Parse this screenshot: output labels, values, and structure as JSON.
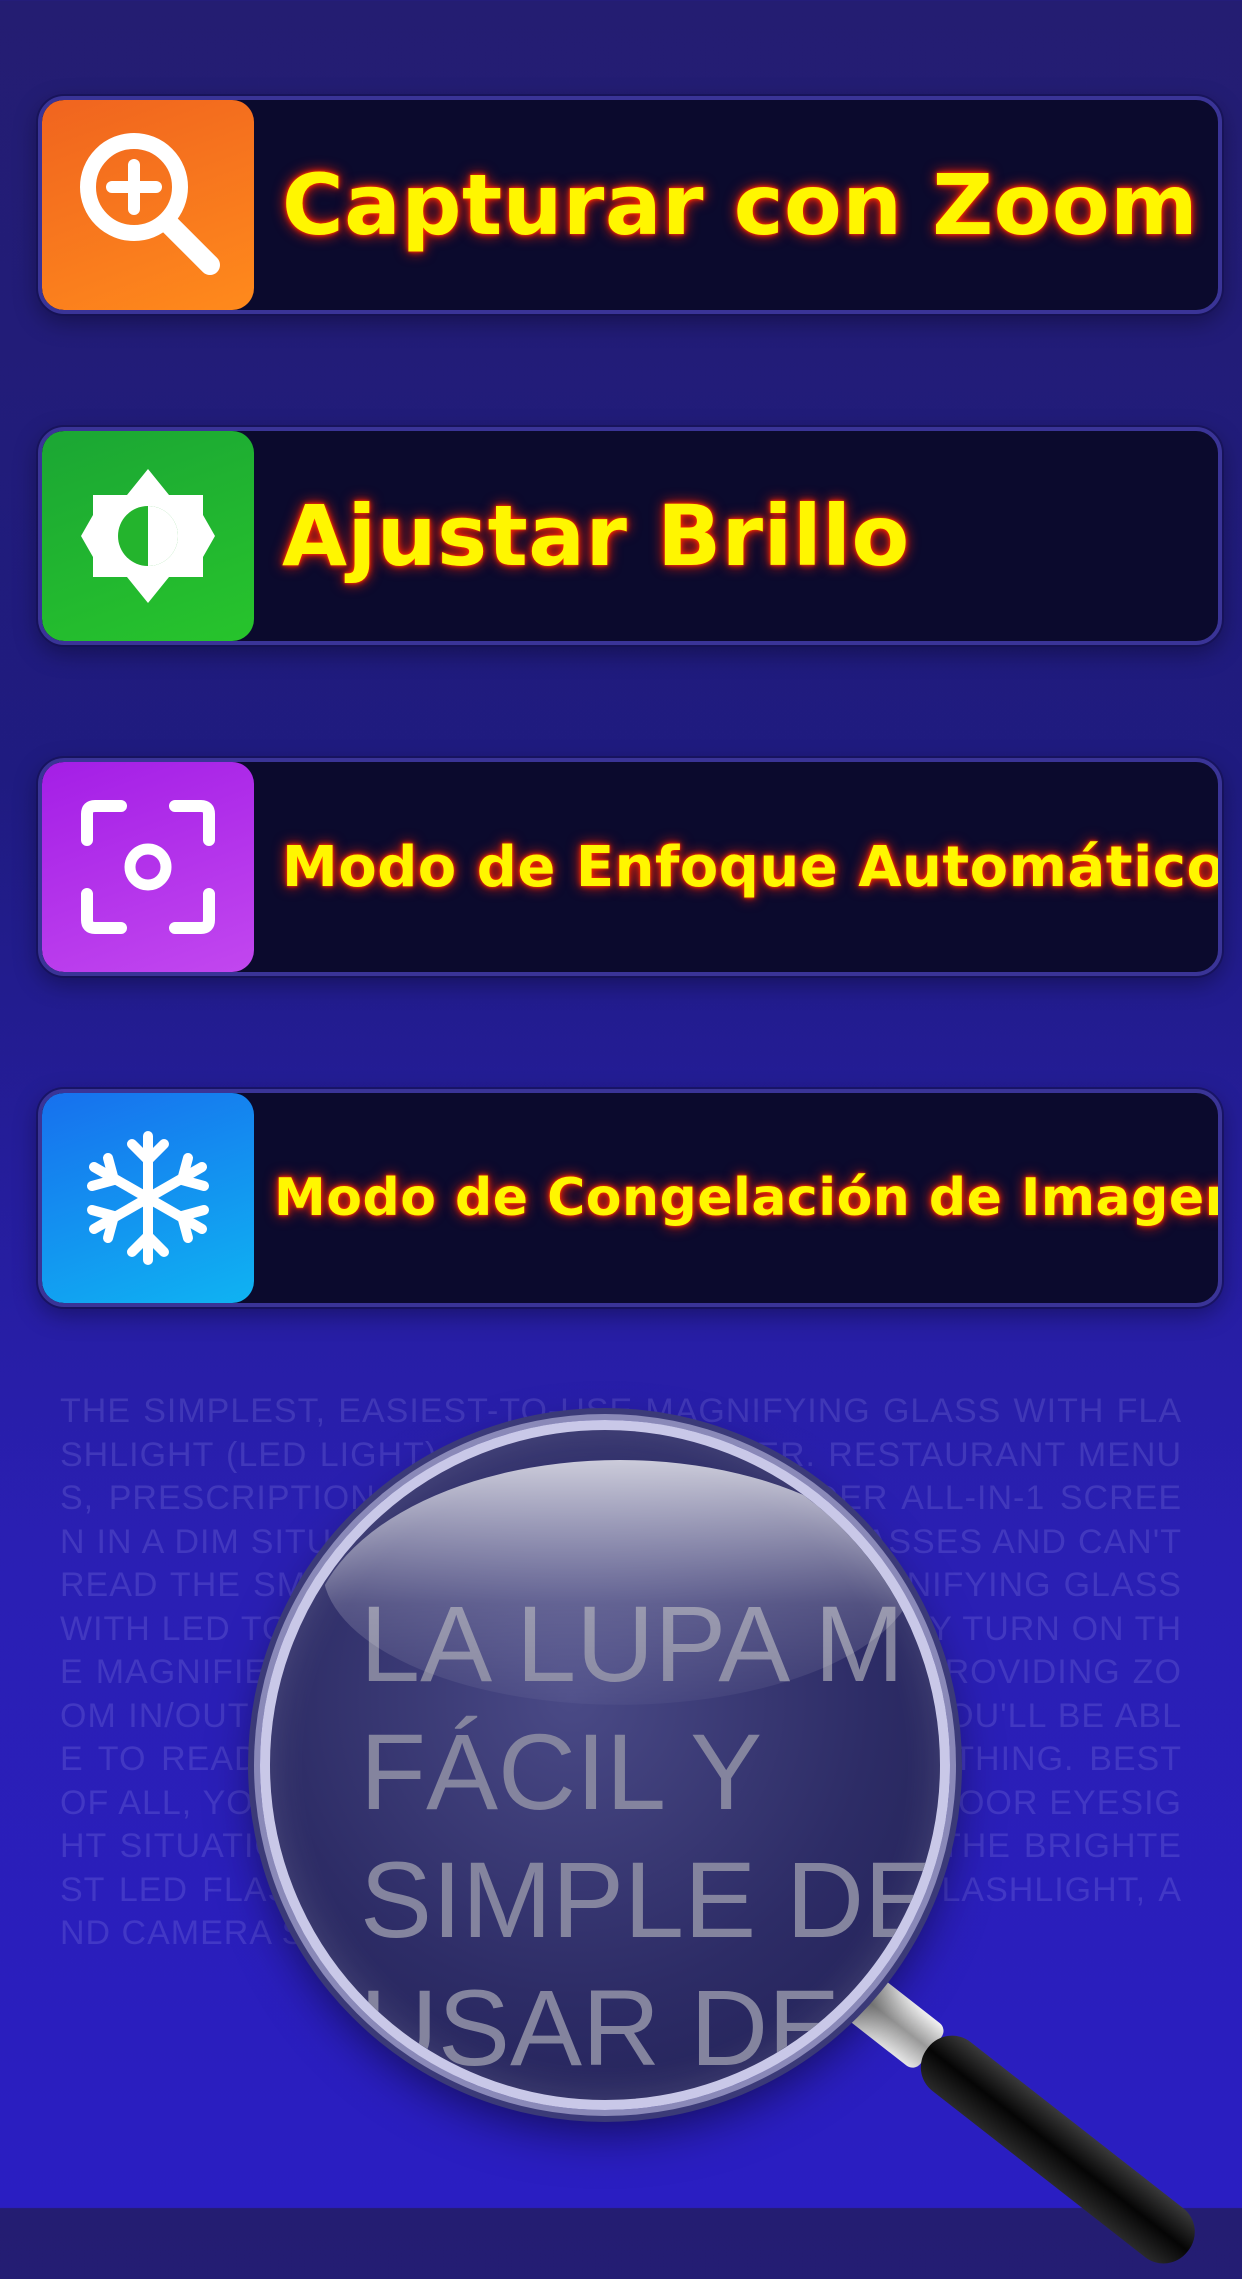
{
  "buttons": [
    {
      "label": "Capturar con Zoom",
      "icon": "zoom-in-icon",
      "color": "#f47a1f"
    },
    {
      "label": "Ajustar Brillo",
      "icon": "brightness-icon",
      "color": "#22b52e"
    },
    {
      "label": "Modo de Enfoque Automático",
      "icon": "autofocus-icon",
      "color": "#b233ea"
    },
    {
      "label": "Modo de Congelación de Imagen",
      "icon": "snowflake-icon",
      "color": "#1493f0"
    }
  ],
  "background_text": "THE SIMPLEST, EASIEST-TO-USE MAGNIFYING GLASS WITH FLASHLIGHT (LED LIGHT), DIGITAL MAGNIFIER. RESTAURANT MENUS, PRESCRIPTION LABELS, BOOKS. CONSIDER ALL-IN-1 SCREEN IN A DIM SITUATION WHEN YOU FORGOT GLASSES AND CAN'T READ THE SMALL PRINT? LET THE DIGITAL MAGNIFYING GLASS WITH LED TORCH LIGHT HANDLE ALL THAT. SIMPLY TURN ON THE MAGNIFIER THAT ENLARGES THE TEXT WHILE PROVIDING ZOOM IN/OUT FURTHER. DOWNLOAD THE APP, AND YOU'LL BE ABLE TO READ CLEARLY. FINALLY YOU'LL SEE EVERYTHING. BEST OF ALL, YOU STOP BLAMING YOUR EYESIGHT OR POOR EYESIGHT SITUATION, TO GETTING IT. YOU'LL ALSO GET THE BRIGHTEST LED FLASHLIGHT. THIS MAGNIFYING GLASS, FLASHLIGHT, AND CAMERA SET.",
  "lens_text": [
    "LA LUPA M",
    "FÁCIL Y",
    "SIMPLE DE",
    "USAR DE"
  ]
}
